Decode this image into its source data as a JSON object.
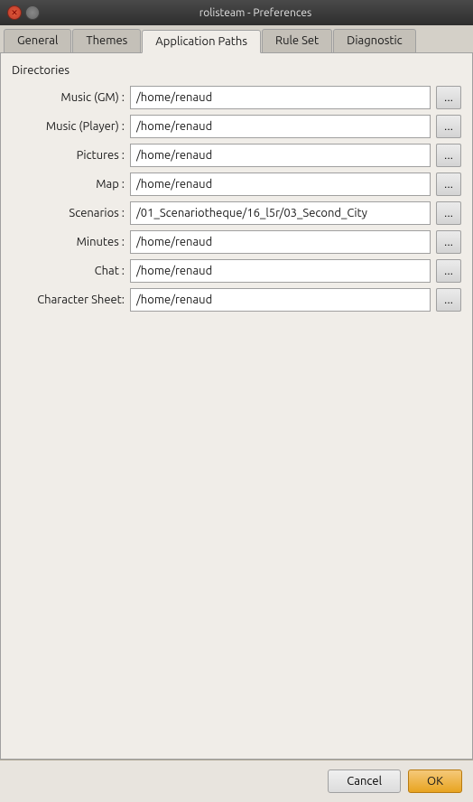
{
  "window": {
    "title": "rolisteam - Preferences"
  },
  "tabs": [
    {
      "id": "general",
      "label": "General",
      "active": false
    },
    {
      "id": "themes",
      "label": "Themes",
      "active": false
    },
    {
      "id": "application-paths",
      "label": "Application Paths",
      "active": true
    },
    {
      "id": "rule-set",
      "label": "Rule Set",
      "active": false
    },
    {
      "id": "diagnostic",
      "label": "Diagnostic",
      "active": false
    }
  ],
  "section": {
    "label": "Directories"
  },
  "fields": [
    {
      "id": "music-gm",
      "label": "Music (GM) :",
      "value": "/home/renaud"
    },
    {
      "id": "music-player",
      "label": "Music (Player) :",
      "value": "/home/renaud"
    },
    {
      "id": "pictures",
      "label": "Pictures :",
      "value": "/home/renaud"
    },
    {
      "id": "map",
      "label": "Map :",
      "value": "/home/renaud"
    },
    {
      "id": "scenarios",
      "label": "Scenarios :",
      "value": "/01_Scenariotheque/16_l5r/03_Second_City"
    },
    {
      "id": "minutes",
      "label": "Minutes :",
      "value": "/home/renaud"
    },
    {
      "id": "chat",
      "label": "Chat :",
      "value": "/home/renaud"
    },
    {
      "id": "character-sheet",
      "label": "Character Sheet:",
      "value": "/home/renaud"
    }
  ],
  "buttons": {
    "browse_label": "...",
    "cancel_label": "Cancel",
    "ok_label": "OK"
  }
}
